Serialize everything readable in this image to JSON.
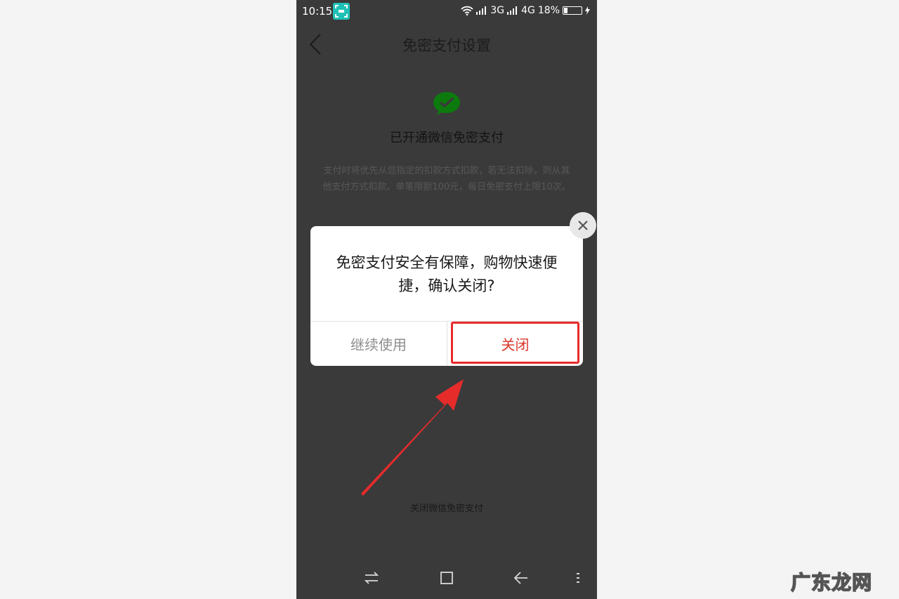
{
  "status_bar": {
    "time": "10:15",
    "network_1": "3G",
    "network_2": "4G",
    "battery": "18%",
    "battery_level": 0.18
  },
  "header": {
    "title": "免密支付设置"
  },
  "main": {
    "status": "已开通微信免密支付",
    "description": "支付时将优先从您指定的扣款方式扣款，若无法扣除，则从其他支付方式扣款。单笔限额100元，每日免密支付上限10次。",
    "bottom_link": "关闭微信免密支付"
  },
  "dialog": {
    "message": "免密支付安全有保障，购物快速便捷，确认关闭?",
    "continue_label": "继续使用",
    "close_label": "关闭"
  },
  "watermark": "广东龙网",
  "colors": {
    "dim_background": "#3a3a3a",
    "close_button_text": "#d9372a",
    "annotation_red": "#e62b2b",
    "wechat_green": "#0d7a0d"
  },
  "icons": {
    "back": "chevron-left-icon",
    "logo": "wechat-icon",
    "dialog_close": "close-icon",
    "nav_switch": "switch-arrows-icon",
    "nav_home": "square-icon",
    "nav_back": "back-arrow-icon",
    "nav_menu": "menu-dots-icon"
  }
}
